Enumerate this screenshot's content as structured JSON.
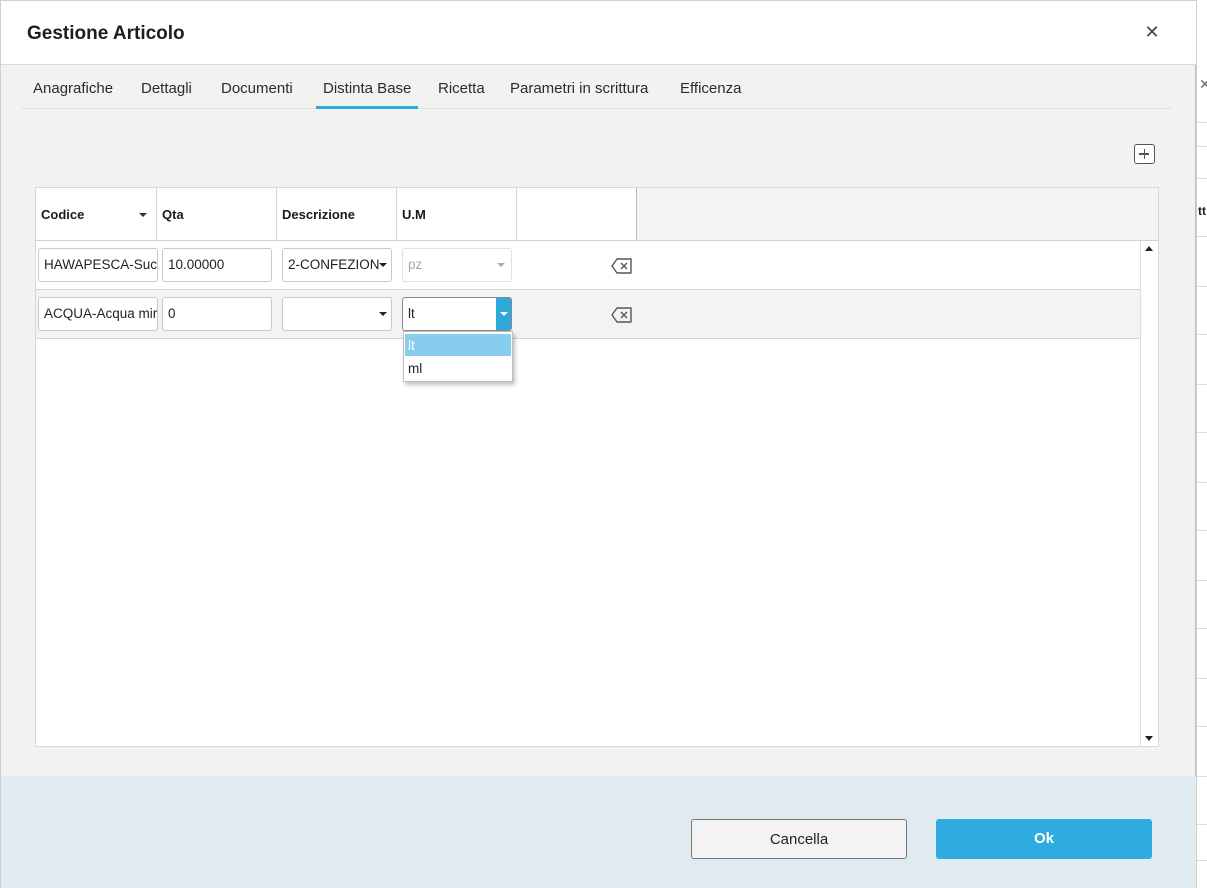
{
  "dialog": {
    "title": "Gestione Articolo"
  },
  "tabs": [
    {
      "label": "Anagrafiche"
    },
    {
      "label": "Dettagli"
    },
    {
      "label": "Documenti"
    },
    {
      "label": "Distinta Base",
      "active": true
    },
    {
      "label": "Ricetta"
    },
    {
      "label": "Parametri in scrittura"
    },
    {
      "label": "Efficenza"
    }
  ],
  "grid": {
    "columns": [
      "Codice",
      "Qta",
      "Descrizione",
      "U.M"
    ],
    "rows": [
      {
        "codice": "HAWAPESCA-Succo",
        "qta": "10.00000",
        "descrizione": "2-CONFEZION",
        "um": "pz",
        "um_disabled": true
      },
      {
        "codice": "ACQUA-Acqua mir",
        "qta": "0",
        "descrizione": "",
        "um": "lt",
        "um_open": true
      }
    ]
  },
  "um_dropdown": {
    "options": [
      "lt",
      "ml"
    ],
    "selected": "lt"
  },
  "footer": {
    "cancel_label": "Cancella",
    "ok_label": "Ok"
  },
  "background": {
    "partial_text": "tt"
  },
  "icons": [
    "close-icon",
    "add-row-icon",
    "sort-caret-icon",
    "delete-row-icon",
    "dropdown-arrow-icon",
    "scroll-up-icon",
    "scroll-down-icon"
  ],
  "colors": {
    "accent": "#2fa8dc",
    "footer_bg": "#e0ebf1",
    "dropdown_selected": "#86cdee"
  }
}
